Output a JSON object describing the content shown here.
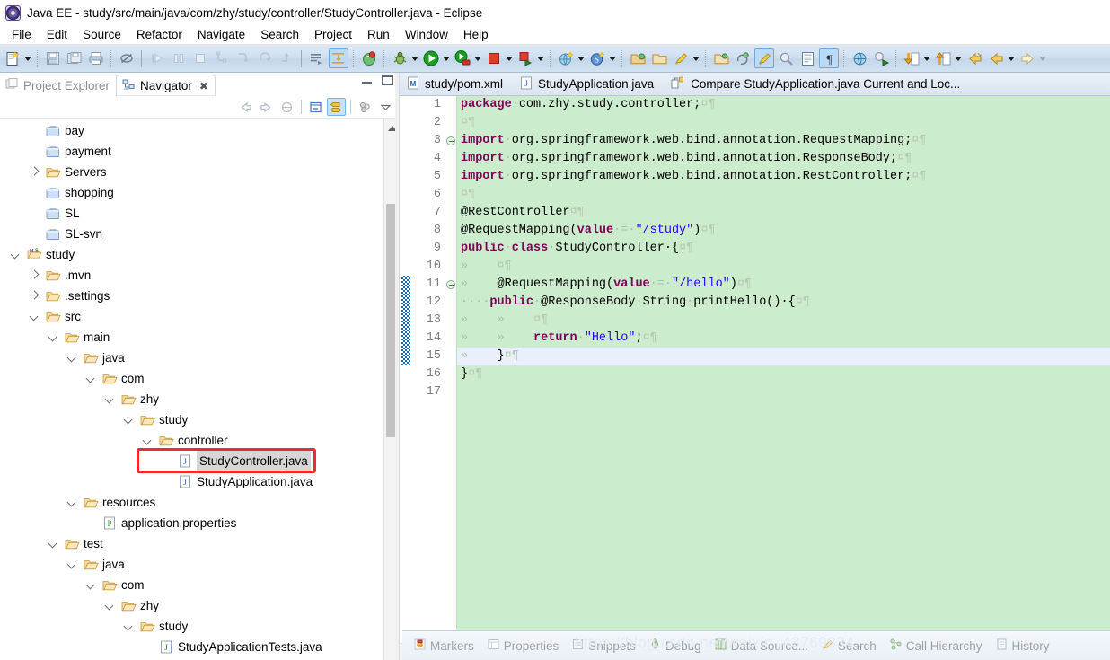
{
  "window": {
    "title": "Java EE - study/src/main/java/com/zhy/study/controller/StudyController.java - Eclipse",
    "app_icon": "eclipse-icon"
  },
  "menubar": {
    "items": [
      {
        "label": "File",
        "mnemonic": "F"
      },
      {
        "label": "Edit",
        "mnemonic": "E"
      },
      {
        "label": "Source",
        "mnemonic": "S"
      },
      {
        "label": "Refactor",
        "mnemonic": "t"
      },
      {
        "label": "Navigate",
        "mnemonic": "N"
      },
      {
        "label": "Search",
        "mnemonic": "a"
      },
      {
        "label": "Project",
        "mnemonic": "P"
      },
      {
        "label": "Run",
        "mnemonic": "R"
      },
      {
        "label": "Window",
        "mnemonic": "W"
      },
      {
        "label": "Help",
        "mnemonic": "H"
      }
    ]
  },
  "toolbar": {
    "icons": [
      "new-wizard-icon",
      "new-dropdown-arrow",
      "save-icon",
      "save-all-icon",
      "print-icon",
      "toggle-breakpoint-icon",
      "resume-icon",
      "suspend-icon",
      "terminate-icon",
      "step-into-icon",
      "step-over-icon",
      "step-return-icon",
      "step-out-icon",
      "open-task-icon",
      "toggle-mark-occurrences-icon",
      "toggle-marks-icon",
      "new-java-class-icon",
      "debug-icon",
      "debug-dropdown-arrow",
      "run-icon",
      "run-dropdown-arrow",
      "run-server-icon",
      "run-server-dropdown-arrow",
      "stop-icon",
      "stop-dropdown-arrow",
      "run-as-icon",
      "run-as-dropdown-arrow",
      "new-web-project-icon",
      "web-dropdown-arrow",
      "new-spring-icon",
      "spring-dropdown-arrow",
      "open-type-icon",
      "open-resource-icon",
      "highlight-icon",
      "highlight-dropdown-arrow",
      "open-perspective-icon",
      "sync-icon",
      "pencil-icon",
      "search-ref-icon",
      "book-icon",
      "pilcrow-icon",
      "globe-icon",
      "run-javascript-icon",
      "next-annotation-icon",
      "next-annotation-arrow",
      "previous-annotation-icon",
      "previous-annotation-arrow",
      "back-icon",
      "back-arrow",
      "forward-icon",
      "forward-arrow",
      "last-edit-icon",
      "last-edit-arrow"
    ]
  },
  "navigator": {
    "tabs": [
      {
        "label": "Project Explorer",
        "icon": "project-explorer-icon",
        "active": false,
        "closable": false
      },
      {
        "label": "Navigator",
        "icon": "navigator-icon",
        "active": true,
        "closable": true,
        "close_glyph": "✖"
      }
    ],
    "view_toolbar": [
      "back-arrow-icon",
      "forward-arrow-icon",
      "home-icon",
      "collapse-all-icon",
      "link-with-editor-icon",
      "view-menu-icon",
      "view-chevron-icon"
    ],
    "panel_buttons": [
      "minimize-icon",
      "maximize-icon"
    ],
    "tree": [
      {
        "label": "pay",
        "depth": 1,
        "icon": "closed-project-icon",
        "expander": "none"
      },
      {
        "label": "payment",
        "depth": 1,
        "icon": "closed-project-icon",
        "expander": "none"
      },
      {
        "label": "Servers",
        "depth": 1,
        "icon": "folder-icon",
        "expander": "collapsed"
      },
      {
        "label": "shopping",
        "depth": 1,
        "icon": "closed-project-icon",
        "expander": "none"
      },
      {
        "label": "SL",
        "depth": 1,
        "icon": "closed-project-icon",
        "expander": "none"
      },
      {
        "label": "SL-svn",
        "depth": 1,
        "icon": "closed-project-icon",
        "expander": "none"
      },
      {
        "label": "study",
        "depth": 0,
        "icon": "maven-project-icon",
        "expander": "expanded"
      },
      {
        "label": ".mvn",
        "depth": 1,
        "icon": "folder-icon",
        "expander": "collapsed"
      },
      {
        "label": ".settings",
        "depth": 1,
        "icon": "folder-icon",
        "expander": "collapsed"
      },
      {
        "label": "src",
        "depth": 1,
        "icon": "folder-icon",
        "expander": "expanded"
      },
      {
        "label": "main",
        "depth": 2,
        "icon": "folder-icon",
        "expander": "expanded"
      },
      {
        "label": "java",
        "depth": 3,
        "icon": "folder-icon",
        "expander": "expanded"
      },
      {
        "label": "com",
        "depth": 4,
        "icon": "folder-icon",
        "expander": "expanded"
      },
      {
        "label": "zhy",
        "depth": 5,
        "icon": "folder-icon",
        "expander": "expanded"
      },
      {
        "label": "study",
        "depth": 6,
        "icon": "folder-icon",
        "expander": "expanded"
      },
      {
        "label": "controller",
        "depth": 7,
        "icon": "folder-icon",
        "expander": "expanded"
      },
      {
        "label": "StudyController.java",
        "depth": 8,
        "icon": "java-file-icon",
        "expander": "none",
        "selected": true,
        "highlighted": true
      },
      {
        "label": "StudyApplication.java",
        "depth": 8,
        "icon": "java-file-icon",
        "expander": "none"
      },
      {
        "label": "resources",
        "depth": 3,
        "icon": "folder-icon",
        "expander": "expanded"
      },
      {
        "label": "application.properties",
        "depth": 4,
        "icon": "properties-file-icon",
        "expander": "none"
      },
      {
        "label": "test",
        "depth": 2,
        "icon": "folder-icon",
        "expander": "expanded"
      },
      {
        "label": "java",
        "depth": 3,
        "icon": "folder-icon",
        "expander": "expanded"
      },
      {
        "label": "com",
        "depth": 4,
        "icon": "folder-icon",
        "expander": "expanded"
      },
      {
        "label": "zhy",
        "depth": 5,
        "icon": "folder-icon",
        "expander": "expanded"
      },
      {
        "label": "study",
        "depth": 6,
        "icon": "folder-icon",
        "expander": "expanded"
      },
      {
        "label": "StudyApplicationTests.java",
        "depth": 7,
        "icon": "java-file-icon",
        "expander": "none"
      }
    ],
    "highlight_color": "#ef2b2b"
  },
  "editor": {
    "tabs": [
      {
        "label": "study/pom.xml",
        "icon": "maven-xml-icon",
        "active": false
      },
      {
        "label": "StudyApplication.java",
        "icon": "java-file-icon",
        "active": false
      },
      {
        "label": "Compare StudyApplication.java Current and Loc...",
        "icon": "compare-icon",
        "active": true
      }
    ],
    "current_line": 15,
    "background": "#ccecce",
    "lines": [
      {
        "n": 1,
        "fold": "none",
        "change": false,
        "segments": [
          {
            "t": "package",
            "c": "kw"
          },
          {
            "t": "·",
            "c": "dotspace"
          },
          {
            "t": "com.zhy.study.controller;",
            "c": "plain"
          },
          {
            "t": "¤¶",
            "c": "ws"
          }
        ]
      },
      {
        "n": 2,
        "fold": "none",
        "change": false,
        "segments": [
          {
            "t": "¤¶",
            "c": "ws"
          }
        ]
      },
      {
        "n": 3,
        "fold": "minus",
        "change": false,
        "segments": [
          {
            "t": "import",
            "c": "kw"
          },
          {
            "t": "·",
            "c": "dotspace"
          },
          {
            "t": "org.springframework.web.bind.annotation.RequestMapping;",
            "c": "plain"
          },
          {
            "t": "¤¶",
            "c": "ws"
          }
        ]
      },
      {
        "n": 4,
        "fold": "none",
        "change": false,
        "segments": [
          {
            "t": "import",
            "c": "kw"
          },
          {
            "t": "·",
            "c": "dotspace"
          },
          {
            "t": "org.springframework.web.bind.annotation.ResponseBody;",
            "c": "plain"
          },
          {
            "t": "¤¶",
            "c": "ws"
          }
        ]
      },
      {
        "n": 5,
        "fold": "none",
        "change": false,
        "segments": [
          {
            "t": "import",
            "c": "kw"
          },
          {
            "t": "·",
            "c": "dotspace"
          },
          {
            "t": "org.springframework.web.bind.annotation.RestController;",
            "c": "plain"
          },
          {
            "t": "¤¶",
            "c": "ws"
          }
        ]
      },
      {
        "n": 6,
        "fold": "none",
        "change": false,
        "segments": [
          {
            "t": "¤¶",
            "c": "ws"
          }
        ]
      },
      {
        "n": 7,
        "fold": "none",
        "change": false,
        "segments": [
          {
            "t": "@RestController",
            "c": "plain"
          },
          {
            "t": "¤¶",
            "c": "ws"
          }
        ]
      },
      {
        "n": 8,
        "fold": "none",
        "change": false,
        "segments": [
          {
            "t": "@RequestMapping(",
            "c": "plain"
          },
          {
            "t": "value",
            "c": "kw"
          },
          {
            "t": "·=·",
            "c": "dotspace"
          },
          {
            "t": "\"/study\"",
            "c": "str"
          },
          {
            "t": ")",
            "c": "plain"
          },
          {
            "t": "¤¶",
            "c": "ws"
          }
        ]
      },
      {
        "n": 9,
        "fold": "none",
        "change": false,
        "segments": [
          {
            "t": "public",
            "c": "kw"
          },
          {
            "t": "·",
            "c": "dotspace"
          },
          {
            "t": "class",
            "c": "kw"
          },
          {
            "t": "·",
            "c": "dotspace"
          },
          {
            "t": "StudyController",
            "c": "plain"
          },
          {
            "t": "·{",
            "c": "plain"
          },
          {
            "t": "¤¶",
            "c": "ws"
          }
        ]
      },
      {
        "n": 10,
        "fold": "none",
        "change": false,
        "segments": [
          {
            "t": "»    ",
            "c": "tab-ar"
          },
          {
            "t": "¤¶",
            "c": "ws"
          }
        ]
      },
      {
        "n": 11,
        "fold": "minus",
        "change": true,
        "segments": [
          {
            "t": "»    ",
            "c": "tab-ar"
          },
          {
            "t": "@RequestMapping(",
            "c": "plain"
          },
          {
            "t": "value",
            "c": "kw"
          },
          {
            "t": "·=·",
            "c": "dotspace"
          },
          {
            "t": "\"/hello\"",
            "c": "str"
          },
          {
            "t": ")",
            "c": "plain"
          },
          {
            "t": "¤¶",
            "c": "ws"
          }
        ]
      },
      {
        "n": 12,
        "fold": "none",
        "change": true,
        "segments": [
          {
            "t": "····",
            "c": "dotspace"
          },
          {
            "t": "public",
            "c": "kw"
          },
          {
            "t": "·",
            "c": "dotspace"
          },
          {
            "t": "@ResponseBody",
            "c": "plain"
          },
          {
            "t": "·",
            "c": "dotspace"
          },
          {
            "t": "String",
            "c": "plain"
          },
          {
            "t": "·",
            "c": "dotspace"
          },
          {
            "t": "printHello()",
            "c": "plain"
          },
          {
            "t": "·{",
            "c": "plain"
          },
          {
            "t": "¤¶",
            "c": "ws"
          }
        ]
      },
      {
        "n": 13,
        "fold": "none",
        "change": true,
        "segments": [
          {
            "t": "»    »    ",
            "c": "tab-ar"
          },
          {
            "t": "¤¶",
            "c": "ws"
          }
        ]
      },
      {
        "n": 14,
        "fold": "none",
        "change": true,
        "segments": [
          {
            "t": "»    »    ",
            "c": "tab-ar"
          },
          {
            "t": "return",
            "c": "kw"
          },
          {
            "t": "·",
            "c": "dotspace"
          },
          {
            "t": "\"Hello\"",
            "c": "str"
          },
          {
            "t": ";",
            "c": "plain"
          },
          {
            "t": "¤¶",
            "c": "ws"
          }
        ]
      },
      {
        "n": 15,
        "fold": "none",
        "change": true,
        "segments": [
          {
            "t": "»    ",
            "c": "tab-ar"
          },
          {
            "t": "}",
            "c": "plain"
          },
          {
            "t": "¤¶",
            "c": "ws"
          }
        ]
      },
      {
        "n": 16,
        "fold": "none",
        "change": false,
        "segments": [
          {
            "t": "}",
            "c": "plain"
          },
          {
            "t": "¤¶",
            "c": "ws"
          }
        ]
      },
      {
        "n": 17,
        "fold": "none",
        "change": false,
        "segments": []
      }
    ],
    "hscroll_glyph": "‹"
  },
  "bottom_views": [
    {
      "label": "Markers",
      "icon": "markers-icon"
    },
    {
      "label": "Properties",
      "icon": "properties-icon"
    },
    {
      "label": "Snippets",
      "icon": "snippets-icon"
    },
    {
      "label": "Debug",
      "icon": "debug-icon"
    },
    {
      "label": "Data Source...",
      "icon": "data-source-icon"
    },
    {
      "label": "Search",
      "icon": "search-icon"
    },
    {
      "label": "Call Hierarchy",
      "icon": "call-hierarchy-icon"
    },
    {
      "label": "History",
      "icon": "history-icon"
    }
  ],
  "watermark": {
    "text": "https://blog.csdn.net/weixin_43769834"
  }
}
